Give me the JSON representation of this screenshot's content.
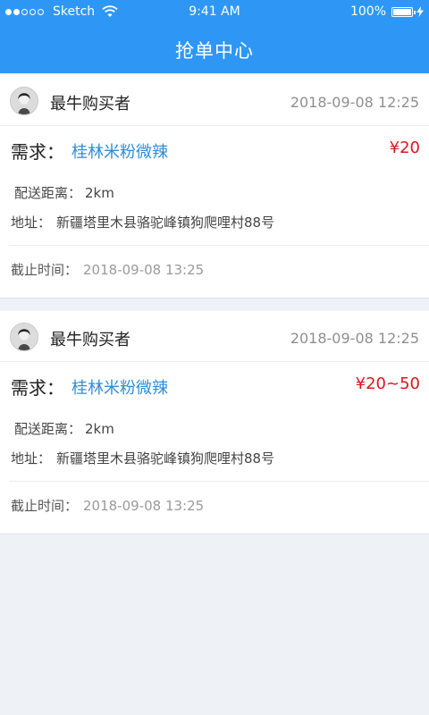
{
  "status_bar": {
    "carrier": "Sketch",
    "time": "9:41 AM",
    "battery": "100%"
  },
  "nav": {
    "title": "抢单中心"
  },
  "orders": [
    {
      "buyer": "最牛购买者",
      "post_time": "2018-09-08 12:25",
      "demand_label": "需求：",
      "demand": "桂林米粉微辣",
      "price": "¥20",
      "distance_label": "配送距离：",
      "distance": "2km",
      "address_label": "地址：",
      "address": "新疆塔里木县骆驼峰镇狗爬哩村88号",
      "deadline_label": "截止时间：",
      "deadline": "2018-09-08 13:25"
    },
    {
      "buyer": "最牛购买者",
      "post_time": "2018-09-08 12:25",
      "demand_label": "需求：",
      "demand": "桂林米粉微辣",
      "price": "¥20~50",
      "distance_label": "配送距离：",
      "distance": "2km",
      "address_label": "地址：",
      "address": "新疆塔里木县骆驼峰镇狗爬哩村88号",
      "deadline_label": "截止时间：",
      "deadline": "2018-09-08 13:25"
    }
  ],
  "colors": {
    "primary": "#2e97f6",
    "link": "#2e8ed6",
    "price": "#e0141c",
    "background": "#eef2f6"
  }
}
